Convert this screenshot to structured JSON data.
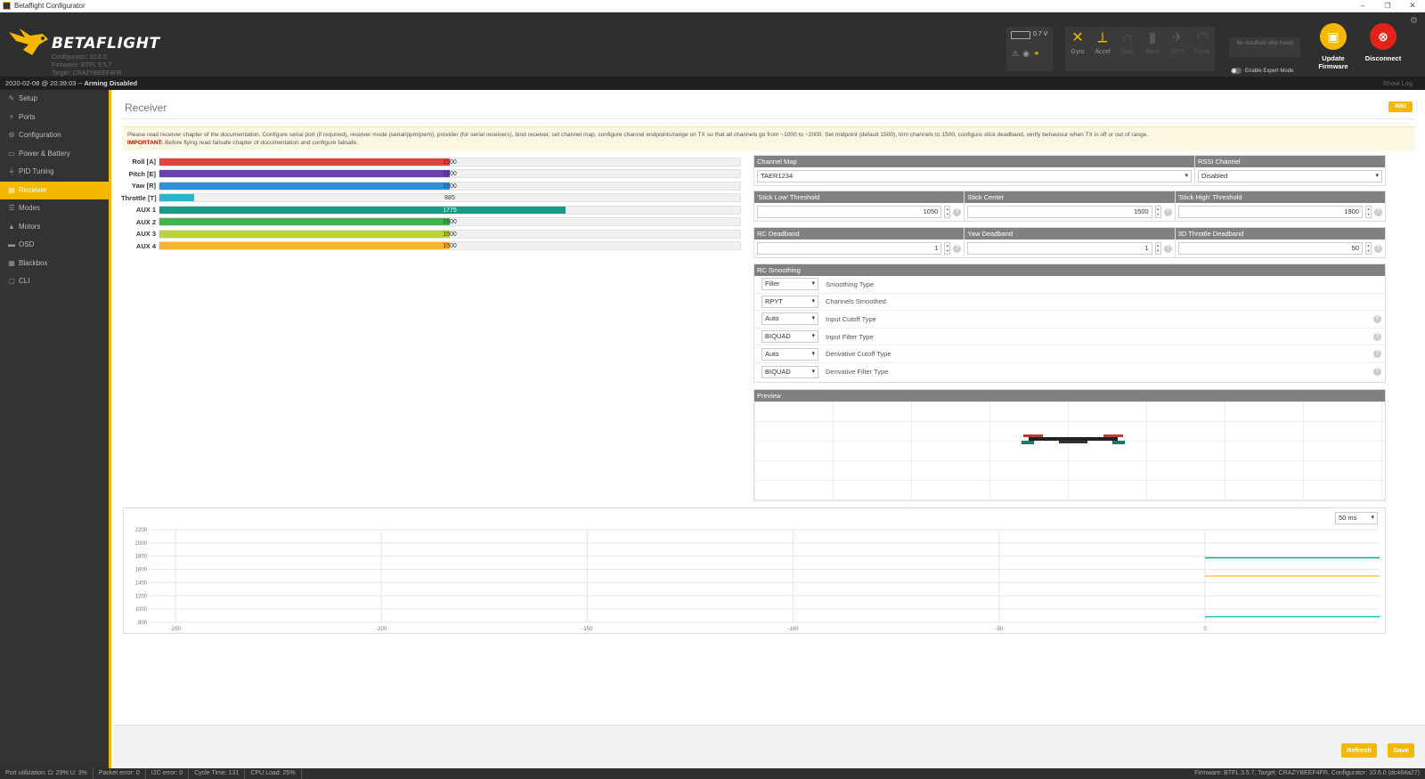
{
  "window": {
    "title": "Betaflight Configurator",
    "controls": [
      "–",
      "❐",
      "✕"
    ]
  },
  "header": {
    "logo_text": "BETAFLIGHT",
    "configurator_version": "Configurator: 10.6.0",
    "firmware_version": "Firmware: BTFL 3.5.7",
    "target": "Target: CRAZYBEEF4FR",
    "battery_voltage": "0.7 V",
    "sensors": [
      {
        "label": "Gyro",
        "icon": "gyro-icon",
        "active": true
      },
      {
        "label": "Accel",
        "icon": "accel-icon",
        "active": true
      },
      {
        "label": "Mag",
        "icon": "mag-icon",
        "active": false
      },
      {
        "label": "Baro",
        "icon": "baro-icon",
        "active": false
      },
      {
        "label": "GPS",
        "icon": "gps-icon",
        "active": false
      },
      {
        "label": "Sonar",
        "icon": "sonar-icon",
        "active": false
      }
    ],
    "dataflash": "No dataflash chip found",
    "expert_mode_label": "Enable Expert Mode",
    "update_firmware": "Update Firmware",
    "disconnect": "Disconnect"
  },
  "status": {
    "datetime": "2020-02-08 @ 20:39:03",
    "separator": " -- ",
    "arming": "Arming Disabled",
    "show_log": "Show Log"
  },
  "nav": [
    {
      "label": "Setup",
      "icon": "wrench-icon",
      "active": false
    },
    {
      "label": "Ports",
      "icon": "plug-icon",
      "active": false
    },
    {
      "label": "Configuration",
      "icon": "gear-icon",
      "active": false
    },
    {
      "label": "Power & Battery",
      "icon": "battery-icon",
      "active": false
    },
    {
      "label": "PID Tuning",
      "icon": "tuning-icon",
      "active": false
    },
    {
      "label": "Receiver",
      "icon": "receiver-icon",
      "active": true
    },
    {
      "label": "Modes",
      "icon": "modes-icon",
      "active": false
    },
    {
      "label": "Motors",
      "icon": "motor-icon",
      "active": false
    },
    {
      "label": "OSD",
      "icon": "osd-icon",
      "active": false
    },
    {
      "label": "Blackbox",
      "icon": "blackbox-icon",
      "active": false
    },
    {
      "label": "CLI",
      "icon": "cli-icon",
      "active": false
    }
  ],
  "page": {
    "title": "Receiver",
    "wiki": "WIKI",
    "note_text": "Please read receiver chapter of the documentation. Configure serial port (if required), receiver mode (serial/ppm/pwm), provider (for serial receivers), bind receiver, set channel map, configure channel endpoints/range on TX so that all channels go from ~1000 to ~2000. Set midpoint (default 1500), trim channels to 1500, configure stick deadband, verify behaviour when TX is off or out of range.",
    "note_important": "IMPORTANT:",
    "note_important_text": " Before flying read failsafe chapter of documentation and configure failsafe."
  },
  "channels": [
    {
      "label": "Roll [A]",
      "value": "1500",
      "level": 0.5,
      "color": "#e8403e"
    },
    {
      "label": "Pitch [E]",
      "value": "1500",
      "level": 0.5,
      "color": "#6a3fb3"
    },
    {
      "label": "Yaw [R]",
      "value": "1500",
      "level": 0.5,
      "color": "#2f8fdc"
    },
    {
      "label": "Throttle [T]",
      "value": "885",
      "level": 0.06,
      "color": "#29b7cf"
    },
    {
      "label": "AUX 1",
      "value": "1775",
      "level": 0.7,
      "color": "#179b86"
    },
    {
      "label": "AUX 2",
      "value": "1500",
      "level": 0.5,
      "color": "#3fb34f"
    },
    {
      "label": "AUX 3",
      "value": "1500",
      "level": 0.5,
      "color": "#bcd13f"
    },
    {
      "label": "AUX 4",
      "value": "1500",
      "level": 0.5,
      "color": "#f5b62e"
    }
  ],
  "settings": {
    "channel_map_header": "Channel Map",
    "channel_map_value": "TAER1234",
    "rssi_header": "RSSI Channel",
    "rssi_value": "Disabled",
    "stick_low_header": "'Stick Low' Threshold",
    "stick_low_value": "1050",
    "stick_center_header": "Stick Center",
    "stick_center_value": "1500",
    "stick_high_header": "'Stick High' Threshold",
    "stick_high_value": "1900",
    "rc_deadband_header": "RC Deadband",
    "rc_deadband_value": "1",
    "yaw_deadband_header": "Yaw Deadband",
    "yaw_deadband_value": "1",
    "throttle3d_header": "3D Throttle Deadband",
    "throttle3d_value": "50"
  },
  "smoothing": {
    "header": "RC Smoothing",
    "rows": [
      {
        "value": "Filter",
        "label": "Smoothing Type",
        "help": false
      },
      {
        "value": "RPYT",
        "label": "Channels Smoothed",
        "help": false
      },
      {
        "value": "Auto",
        "label": "Input Cutoff Type",
        "help": true
      },
      {
        "value": "BIQUAD",
        "label": "Input Filter Type",
        "help": true
      },
      {
        "value": "Auto",
        "label": "Derivative Cutoff Type",
        "help": true
      },
      {
        "value": "BIQUAD",
        "label": "Derivative Filter Type",
        "help": true
      }
    ]
  },
  "preview_header": "Preview",
  "graph": {
    "refresh_rate": "50 ms",
    "y_ticks": [
      "2200",
      "2000",
      "1800",
      "1600",
      "1400",
      "1200",
      "1000",
      "800"
    ],
    "x_ticks": [
      "-250",
      "-200",
      "-150",
      "-100",
      "-50",
      "0"
    ],
    "series_colors": [
      "#179b86",
      "#f5b62e",
      "#29b7cf"
    ]
  },
  "footer": {
    "refresh": "Refresh",
    "save": "Save"
  },
  "bottom": {
    "port_util": "Port utilization: D: 29% U: 3%",
    "packet_error": "Packet error: 0",
    "i2c_error": "I2C error: 0",
    "cycle_time": "Cycle Time: 131",
    "cpu_load": "CPU Load: 25%",
    "firmware_info": "Firmware: BTFL 3.5.7, Target: CRAZYBEEF4FR, Configurator: 10.6.0 (dc484a27)"
  }
}
